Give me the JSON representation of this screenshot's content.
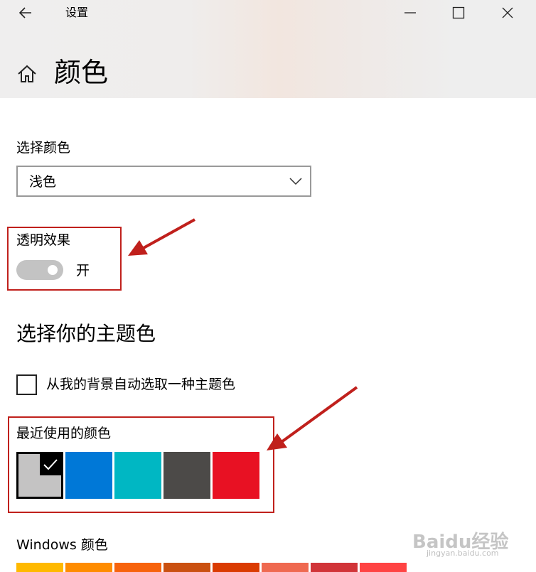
{
  "window": {
    "title": "设置",
    "back_icon": "arrow-left-icon",
    "minimize_icon": "minimize-icon",
    "maximize_icon": "maximize-icon",
    "close_icon": "close-icon"
  },
  "page": {
    "home_icon": "home-icon",
    "title": "颜色"
  },
  "choose_color": {
    "label": "选择颜色",
    "selected_value": "浅色"
  },
  "transparency": {
    "label": "透明效果",
    "state_text": "开",
    "is_on": true
  },
  "accent": {
    "section_title": "选择你的主题色",
    "auto_pick_label": "从我的背景自动选取一种主题色",
    "auto_pick_checked": false
  },
  "recent_colors": {
    "label": "最近使用的颜色",
    "swatches": [
      "#c4c3c3",
      "#0078d7",
      "#00b7c3",
      "#4c4a48",
      "#e81123"
    ],
    "selected_index": 0
  },
  "windows_colors": {
    "label": "Windows 颜色",
    "swatches": [
      "#ffb900",
      "#ff8c00",
      "#f7630c",
      "#ca5010",
      "#da3b01",
      "#ef6950",
      "#d13438",
      "#ff4343"
    ]
  },
  "annotations": {
    "callout_color": "#c0201c"
  },
  "watermark": {
    "text": "Baidu经验",
    "sub": "jingyan.baidu.com"
  }
}
